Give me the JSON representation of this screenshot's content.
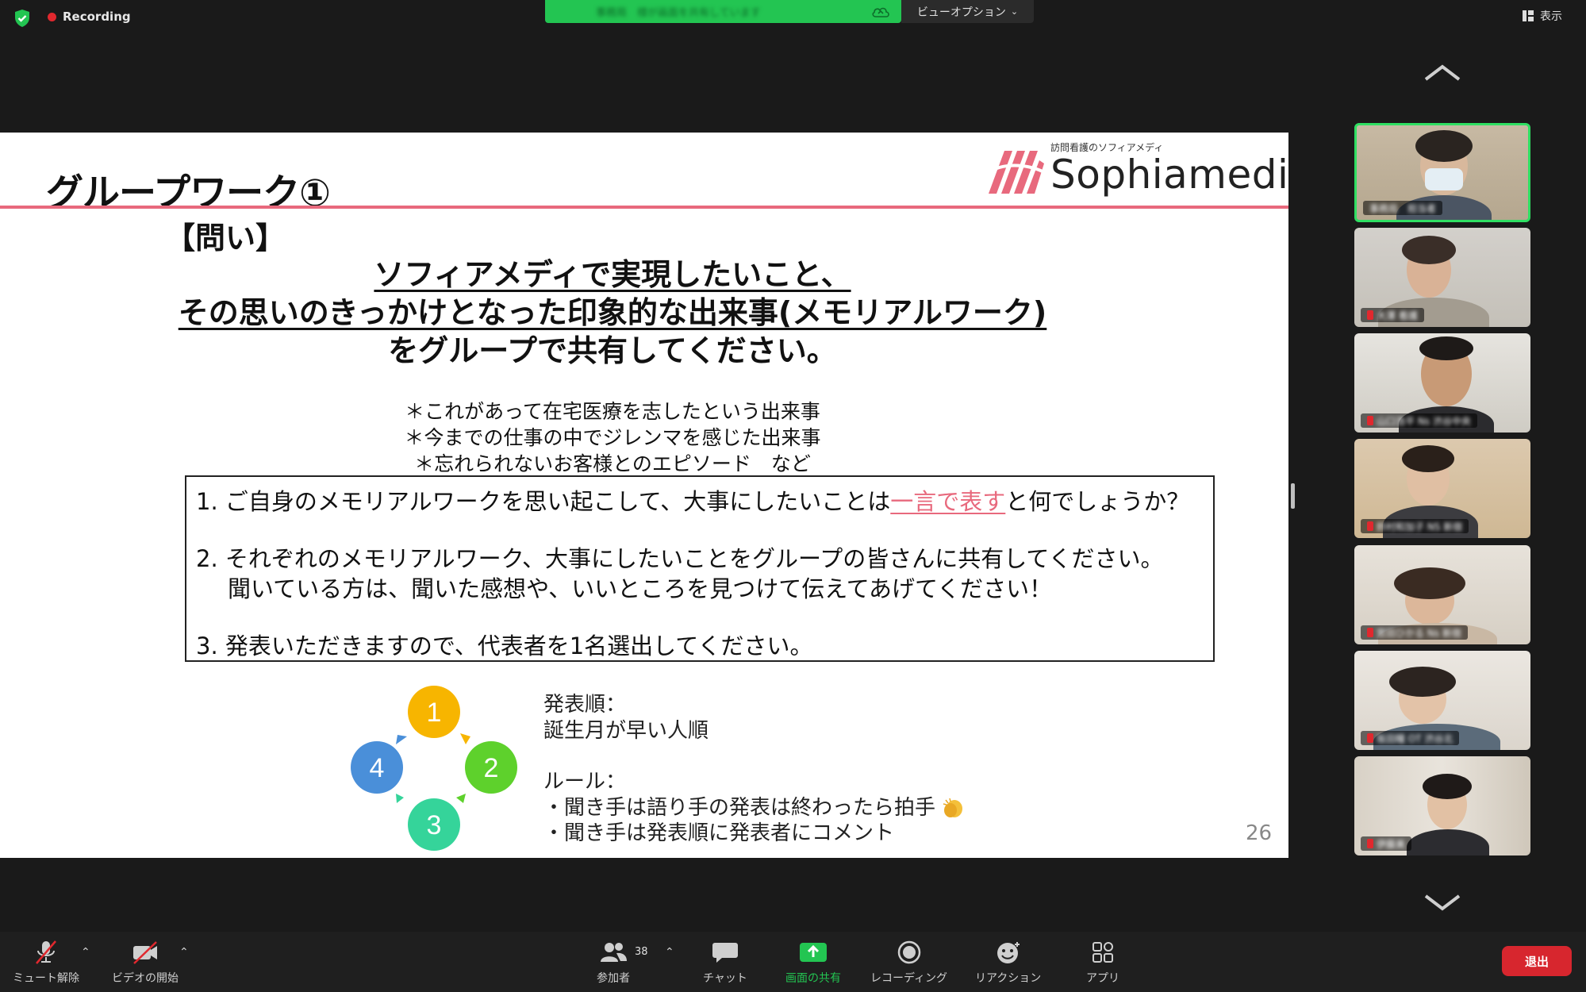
{
  "top_bar": {
    "recording_label": "Recording",
    "share_banner_text": "事務局　様が画面を共有しています",
    "view_options_label": "ビューオプション",
    "view_button_label": "表示"
  },
  "slide": {
    "title": "グループワーク①",
    "logo_sub": "訪問看護のソフィアメディ",
    "logo_name": "Sophiamedi",
    "question_label": "【問い】",
    "question_line1": "ソフィアメディで実現したいこと、",
    "question_line2": "その思いのきっかけとなった印象的な出来事(メモリアルワーク)",
    "question_line3": "をグループで共有してください。",
    "note1": "＊これがあって在宅医療を志したという出来事",
    "note2": "＊今までの仕事の中でジレンマを感じた出来事",
    "note3": "＊忘れられないお客様とのエピソード　など",
    "step1_pre": "1. ご自身のメモリアルワークを思い起こして、大事にしたいことは",
    "step1_highlight": "一言で表す",
    "step1_post": "と何でしょうか？",
    "step2_line1": "2. それぞれのメモリアルワーク、大事にしたいことをグループの皆さんに共有してください。",
    "step2_line2": "聞いている方は、聞いた感想や、いいところを見つけて伝えてあげてください！",
    "step3": "3. 発表いただきますので、代表者を1名選出してください。",
    "cycle_labels": [
      "1",
      "2",
      "3",
      "4"
    ],
    "order_label": "発表順：",
    "order_value": "誕生月が早い人順",
    "rules_label": "ルール：",
    "rule1": "・聞き手は語り手の発表は終わったら拍手",
    "rule2": "・聞き手は発表順に発表者にコメント",
    "page_number": "26",
    "colors": {
      "accent_line": "#e8697d",
      "c1": "#f7b500",
      "c2": "#5ed12c",
      "c3": "#35d49a",
      "c4": "#4a8fd9"
    }
  },
  "gallery": {
    "tiles": [
      {
        "name": "事務局　担当者",
        "active": true
      },
      {
        "name": "大澤 看護",
        "active": false
      },
      {
        "name": "山口浩平 Ns 渋谷中央",
        "active": false
      },
      {
        "name": "鈴村和加子 NS 新宿",
        "active": false
      },
      {
        "name": "宮田ひかる Ns 新宿",
        "active": false
      },
      {
        "name": "坂田瞳 OT 渋谷北",
        "active": false
      },
      {
        "name": "伊藤美",
        "active": false
      }
    ]
  },
  "toolbar": {
    "mute_label": "ミュート解除",
    "video_label": "ビデオの開始",
    "participants_label": "参加者",
    "participants_count": "38",
    "chat_label": "チャット",
    "share_label": "画面の共有",
    "recording_label": "レコーディング",
    "reaction_label": "リアクション",
    "apps_label": "アプリ",
    "leave_label": "退出"
  }
}
